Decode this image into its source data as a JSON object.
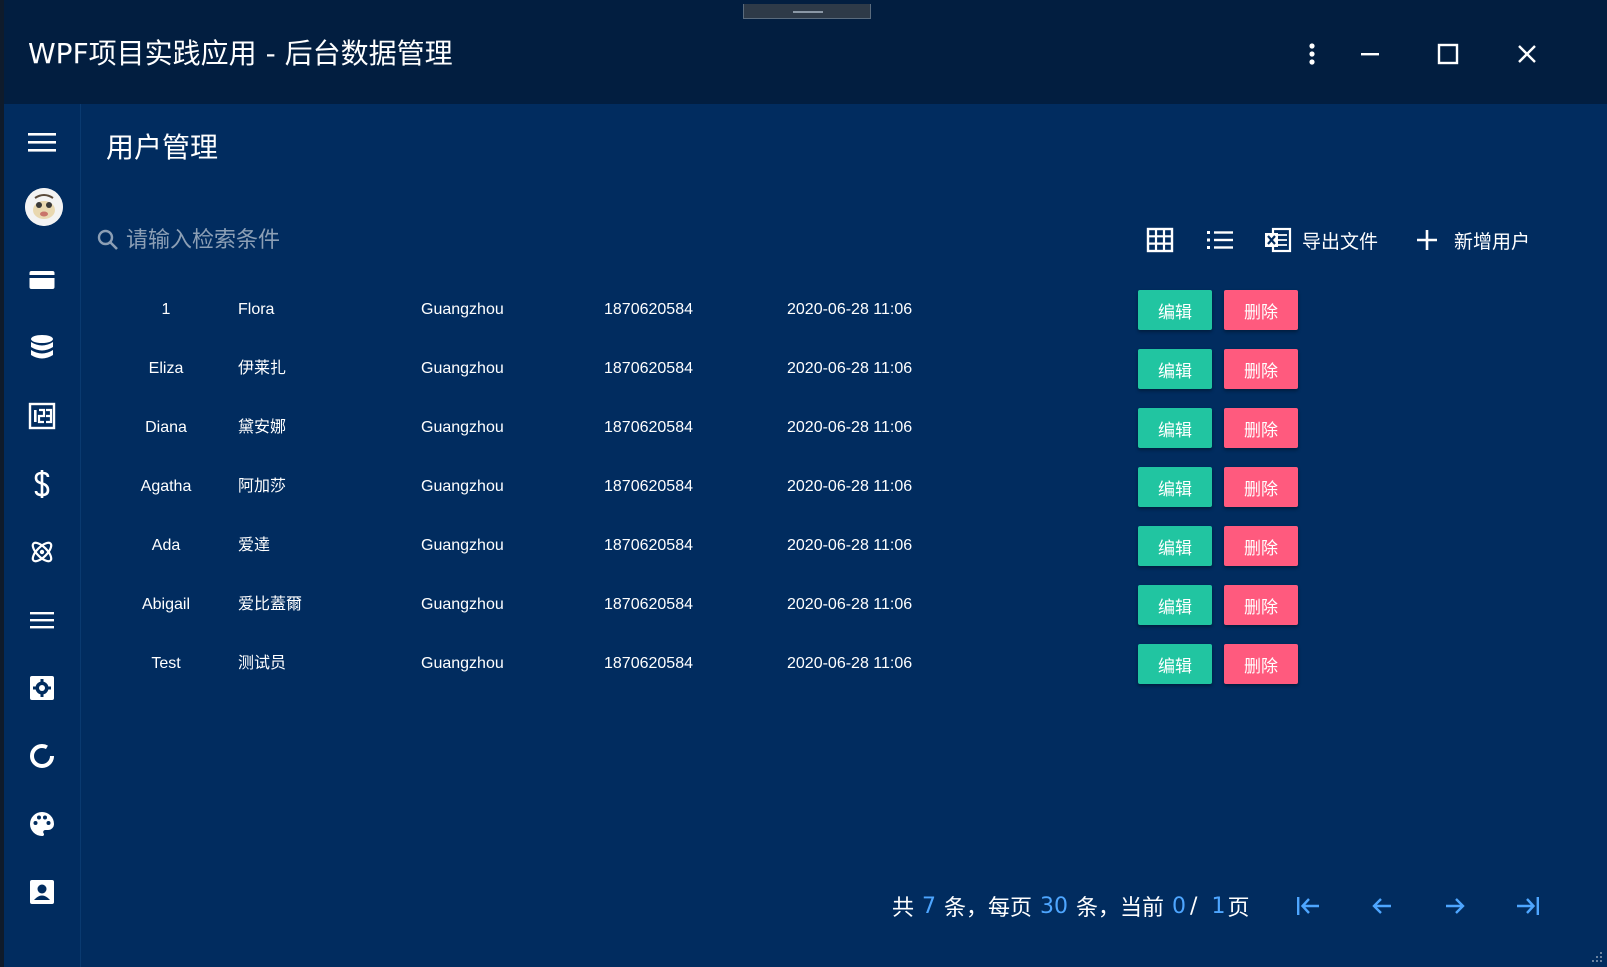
{
  "window": {
    "title": "WPF项目实践应用 - 后台数据管理"
  },
  "page": {
    "title": "用户管理"
  },
  "search": {
    "placeholder": "请输入检索条件"
  },
  "toolbar": {
    "export_label": "导出文件",
    "add_label": "新增用户"
  },
  "actions": {
    "edit_label": "编辑",
    "delete_label": "删除"
  },
  "users": [
    {
      "id": "1",
      "name": "Flora",
      "city": "Guangzhou",
      "phone": "1870620584",
      "date": "2020-06-28 11:06"
    },
    {
      "id": "Eliza",
      "name": "伊莱扎",
      "city": "Guangzhou",
      "phone": "1870620584",
      "date": "2020-06-28 11:06"
    },
    {
      "id": "Diana",
      "name": "黛安娜",
      "city": "Guangzhou",
      "phone": "1870620584",
      "date": "2020-06-28 11:06"
    },
    {
      "id": "Agatha",
      "name": "阿加莎",
      "city": "Guangzhou",
      "phone": "1870620584",
      "date": "2020-06-28 11:06"
    },
    {
      "id": "Ada",
      "name": "爱達",
      "city": "Guangzhou",
      "phone": "1870620584",
      "date": "2020-06-28 11:06"
    },
    {
      "id": "Abigail",
      "name": "爱比蓋爾",
      "city": "Guangzhou",
      "phone": "1870620584",
      "date": "2020-06-28 11:06"
    },
    {
      "id": "Test",
      "name": "测试员",
      "city": "Guangzhou",
      "phone": "1870620584",
      "date": "2020-06-28 11:06"
    }
  ],
  "pager": {
    "total_prefix": "共",
    "total": "7",
    "per_page_prefix": "条，每页",
    "per_page": "30",
    "current_prefix": "条，当前",
    "current": "0",
    "separator": "/",
    "pages": "1",
    "pages_suffix": "页"
  },
  "colors": {
    "background": "#012c5f",
    "titlebar": "#021e40",
    "edit": "#21c5a1",
    "delete": "#ff5a7e",
    "accent": "#4ea6ff"
  }
}
